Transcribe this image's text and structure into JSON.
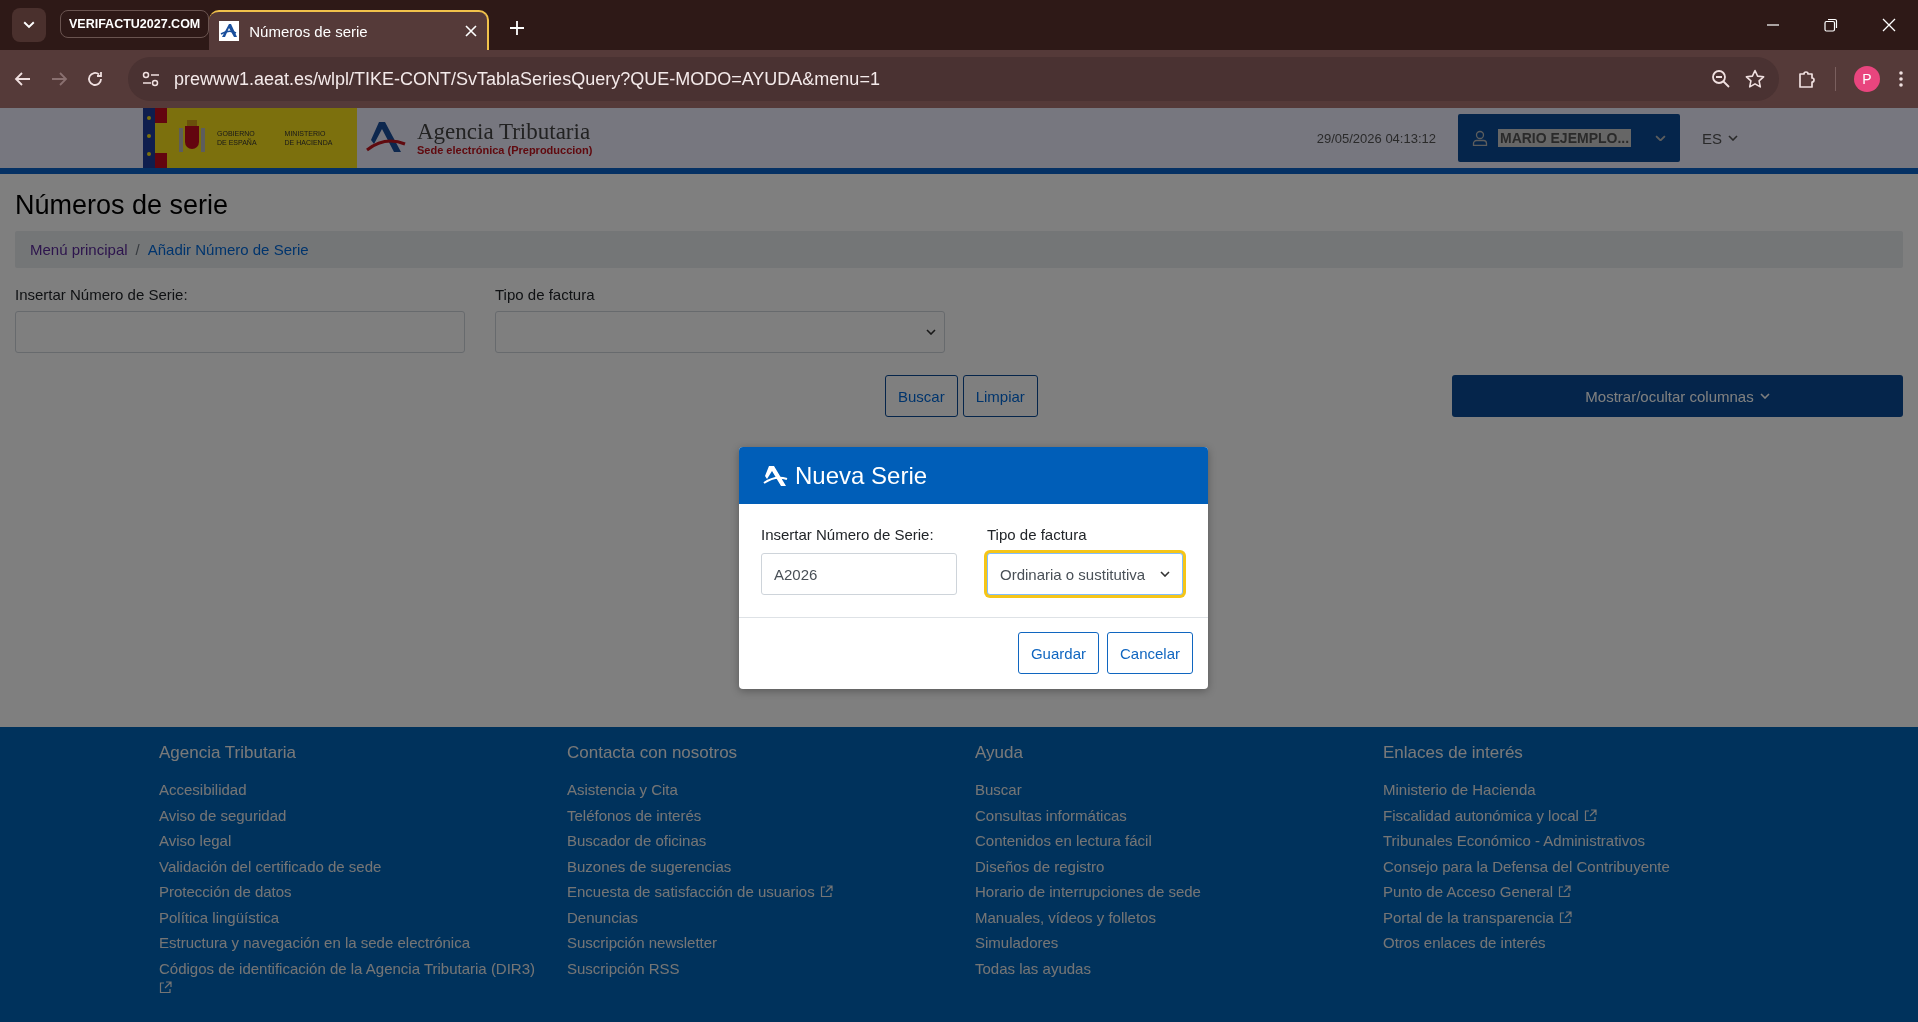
{
  "browser": {
    "tab_group": "VERIFACTU2027.COM",
    "tabs": [
      {
        "title": "Números de serie",
        "selected": true
      }
    ],
    "forward": {
      "disabled": true
    },
    "url": "prewww1.aeat.es/wlpl/TIKE-CONT/SvTablaSeriesQuery?QUE-MODO=AYUDA&menu=1",
    "profile_initial": "P"
  },
  "header": {
    "gov_line_1": "GOBIERNO",
    "gov_line_2": "DE ESPAÑA",
    "ministry_line_1": "MINISTERIO",
    "ministry_line_2": "DE HACIENDA",
    "brand": "Agencia Tributaria",
    "brand_subtitle": "Sede electrónica (Preproduccion)",
    "datetime": "29/05/2026 04:13:12",
    "user": "MARIO EJEMPLO...",
    "language": "ES"
  },
  "page": {
    "title": "Números de serie",
    "breadcrumb": {
      "separator": "/",
      "items": [
        {
          "label": "Menú principal",
          "visited": true
        },
        {
          "label": "Añadir Número de Serie",
          "visited": false
        }
      ]
    },
    "filters": [
      {
        "label": "Insertar Número de Serie:",
        "kind": "text"
      },
      {
        "label": "Tipo de factura",
        "kind": "select"
      }
    ],
    "buttons": [
      "Buscar",
      "Limpiar"
    ],
    "columns_button": "Mostrar/ocultar columnas"
  },
  "modal": {
    "title": "Nueva Serie",
    "fields": [
      {
        "label": "Insertar Número de Serie:",
        "kind": "text",
        "value": "A2026",
        "focused": false
      },
      {
        "label": "Tipo de factura",
        "kind": "select",
        "value": "Ordinaria o sustitutiva",
        "focused": true
      }
    ],
    "buttons": [
      "Guardar",
      "Cancelar"
    ]
  },
  "footer": [
    {
      "title": "Agencia Tributaria",
      "links": [
        {
          "label": "Accesibilidad",
          "external": false
        },
        {
          "label": "Aviso de seguridad",
          "external": false
        },
        {
          "label": "Aviso legal",
          "external": false
        },
        {
          "label": "Validación del certificado de sede",
          "external": false
        },
        {
          "label": "Protección de datos",
          "external": false
        },
        {
          "label": "Política lingüística",
          "external": false
        },
        {
          "label": "Estructura y navegación en la sede electrónica",
          "external": false
        },
        {
          "label": "Códigos de identificación de la Agencia Tributaria (DIR3)",
          "external": true
        }
      ]
    },
    {
      "title": "Contacta con nosotros",
      "links": [
        {
          "label": "Asistencia y Cita",
          "external": false
        },
        {
          "label": "Teléfonos de interés",
          "external": false
        },
        {
          "label": "Buscador de oficinas",
          "external": false
        },
        {
          "label": "Buzones de sugerencias",
          "external": false
        },
        {
          "label": "Encuesta de satisfacción de usuarios",
          "external": true
        },
        {
          "label": "Denuncias",
          "external": false
        },
        {
          "label": "Suscripción newsletter",
          "external": false
        },
        {
          "label": "Suscripción RSS",
          "external": false
        }
      ]
    },
    {
      "title": "Ayuda",
      "links": [
        {
          "label": "Buscar",
          "external": false
        },
        {
          "label": "Consultas informáticas",
          "external": false
        },
        {
          "label": "Contenidos en lectura fácil",
          "external": false
        },
        {
          "label": "Diseños de registro",
          "external": false
        },
        {
          "label": "Horario de interrupciones de sede",
          "external": false
        },
        {
          "label": "Manuales, vídeos y folletos",
          "external": false
        },
        {
          "label": "Simuladores",
          "external": false
        },
        {
          "label": "Todas las ayudas",
          "external": false
        }
      ]
    },
    {
      "title": "Enlaces de interés",
      "links": [
        {
          "label": "Ministerio de Hacienda",
          "external": false
        },
        {
          "label": "Fiscalidad autonómica y local",
          "external": true
        },
        {
          "label": "Tribunales Económico - Administrativos",
          "external": false
        },
        {
          "label": "Consejo para la Defensa del Contribuyente",
          "external": false
        },
        {
          "label": "Punto de Acceso General",
          "external": true
        },
        {
          "label": "Portal de la transparencia",
          "external": true
        },
        {
          "label": "Otros enlaces de interés",
          "external": false
        }
      ]
    }
  ]
}
